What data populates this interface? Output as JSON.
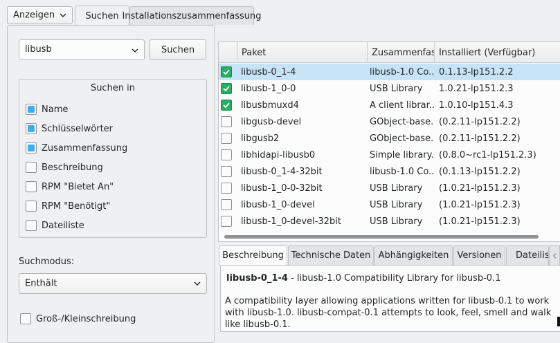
{
  "toolbar": {
    "view_combo": "Anzeigen",
    "tabs": [
      "Suchen",
      "Installationszusammenfassung"
    ]
  },
  "search": {
    "query": "libusb",
    "button": "Suchen",
    "group_title": "Suchen in",
    "options": [
      {
        "label": "Name",
        "checked": true
      },
      {
        "label": "Schlüsselwörter",
        "checked": true
      },
      {
        "label": "Zusammenfassung",
        "checked": true
      },
      {
        "label": "Beschreibung",
        "checked": false
      },
      {
        "label": "RPM \"Bietet An\"",
        "checked": false
      },
      {
        "label": "RPM \"Benötigt\"",
        "checked": false
      },
      {
        "label": "Dateiliste",
        "checked": false
      }
    ],
    "mode_label": "Suchmodus:",
    "mode_value": "Enthält",
    "case_label": "Groß-/Kleinschreibung"
  },
  "packages": {
    "columns": [
      "Paket",
      "Zusammenfassung",
      "Installiert (Verfügbar)"
    ],
    "rows": [
      {
        "name": "libusb-0_1-4",
        "summary": "libusb-1.0 Co...",
        "version": "0.1.13-lp151.2.2",
        "installed": true
      },
      {
        "name": "libusb-1_0-0",
        "summary": "USB Library",
        "version": "1.0.21-lp151.2.3",
        "installed": true
      },
      {
        "name": "libusbmuxd4",
        "summary": "A client librar...",
        "version": "1.0.10-lp151.4.3",
        "installed": true
      },
      {
        "name": "libgusb-devel",
        "summary": "GObject-base...",
        "version": "(0.2.11-lp151.2.2)",
        "installed": false
      },
      {
        "name": "libgusb2",
        "summary": "GObject-base...",
        "version": "(0.2.11-lp151.2.2)",
        "installed": false
      },
      {
        "name": "libhidapi-libusb0",
        "summary": "Simple library...",
        "version": "(0.8.0~rc1-lp151.2.3)",
        "installed": false
      },
      {
        "name": "libusb-0_1-4-32bit",
        "summary": "libusb-1.0 Co...",
        "version": "(0.1.13-lp151.2.2)",
        "installed": false
      },
      {
        "name": "libusb-1_0-0-32bit",
        "summary": "USB Library",
        "version": "(1.0.21-lp151.2.3)",
        "installed": false
      },
      {
        "name": "libusb-1_0-devel",
        "summary": "USB Library",
        "version": "(1.0.21-lp151.2.3)",
        "installed": false
      },
      {
        "name": "libusb-1_0-devel-32bit",
        "summary": "USB Library",
        "version": "(1.0.21-lp151.2.3)",
        "installed": false
      }
    ]
  },
  "details": {
    "tabs": [
      "Beschreibung",
      "Technische Daten",
      "Abhängigkeiten",
      "Versionen",
      "Dateilist"
    ],
    "package_name": "libusb-0_1-4",
    "package_summary": " - libusb-1.0 Compatibility Library for libusb-0.1",
    "description": "A compatibility layer allowing applications written for libusb-0.1 to work with libusb-1.0. libusb-compat-0.1 attempts to look, feel, smell and walk like libusb-0.1."
  }
}
